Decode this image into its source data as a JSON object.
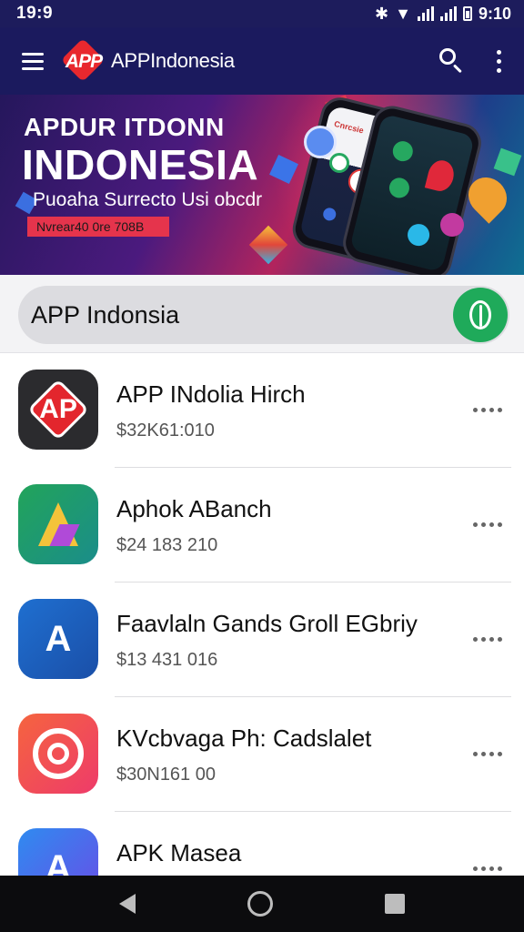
{
  "status_bar": {
    "time": "19:9",
    "clock_right": "9:10"
  },
  "app_bar": {
    "logo_text": "APP",
    "title": "APPIndonesia"
  },
  "banner": {
    "headline": "APDUR ITDONN",
    "title": "INDONESIA",
    "subtitle": "Puoaha Surrecto Usi obcdr",
    "badge": "Nvrear40 0re 708B",
    "phone_header": "Cnrcsie"
  },
  "search": {
    "value": "APP Indonsia"
  },
  "apps": [
    {
      "name": "APP INdolia Hirch",
      "price": "$32K61:010",
      "icon": "app-indonesia-logo-icon",
      "glyph": "AP",
      "colors": [
        "#2b2b2e",
        "#e3262d"
      ]
    },
    {
      "name": "Aphok ABanch",
      "price": "$24 183 210",
      "icon": "triangle-a-icon",
      "glyph": "",
      "colors": [
        "#22a45a",
        "#1a8d8a"
      ]
    },
    {
      "name": "Faavlaln Gands Groll EGbriy",
      "price": "$13 431 016",
      "icon": "letter-a-badge-icon",
      "glyph": "A",
      "colors": [
        "#1f6fd0",
        "#1a4fa8"
      ]
    },
    {
      "name": "KVcbvaga Ph: Cadslalet",
      "price": "$30N161 00",
      "icon": "camera-ring-icon",
      "glyph": "",
      "colors": [
        "#f5643f",
        "#ee3b6a"
      ]
    },
    {
      "name": "APK Masea",
      "price": "",
      "icon": "letter-a-icon",
      "glyph": "A",
      "colors": [
        "#2f8bf0",
        "#6a4ce6"
      ]
    }
  ],
  "colors": {
    "app_bar": "#1b1a5e",
    "accent_green": "#1faa5a",
    "brand_red": "#e8282e"
  }
}
